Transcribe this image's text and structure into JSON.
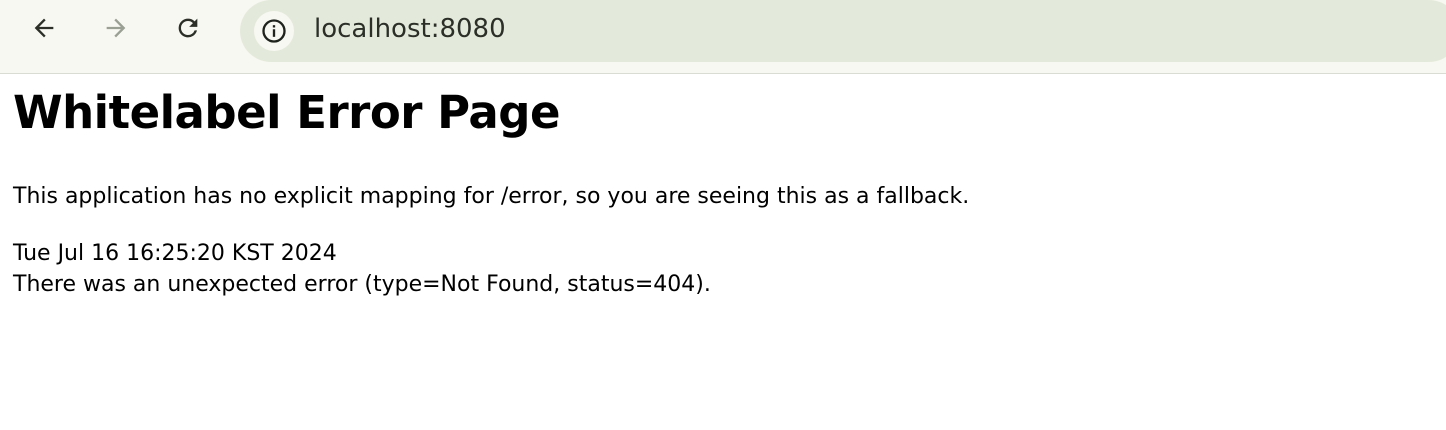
{
  "browser": {
    "url": "localhost:8080",
    "buttons": {
      "back": "back-arrow-icon",
      "forward": "forward-arrow-icon",
      "reload": "reload-icon",
      "info": "info-icon"
    },
    "colors": {
      "toolbar_bg": "#f7f8f1",
      "omnibox_bg": "#e4eadb",
      "forward_disabled": "#9aa094"
    }
  },
  "page": {
    "title": "Whitelabel Error Page",
    "explanation": "This application has no explicit mapping for /error, so you are seeing this as a fallback.",
    "timestamp": "Tue Jul 16 16:25:20 KST 2024",
    "error_message": "There was an unexpected error (type=Not Found, status=404)."
  }
}
